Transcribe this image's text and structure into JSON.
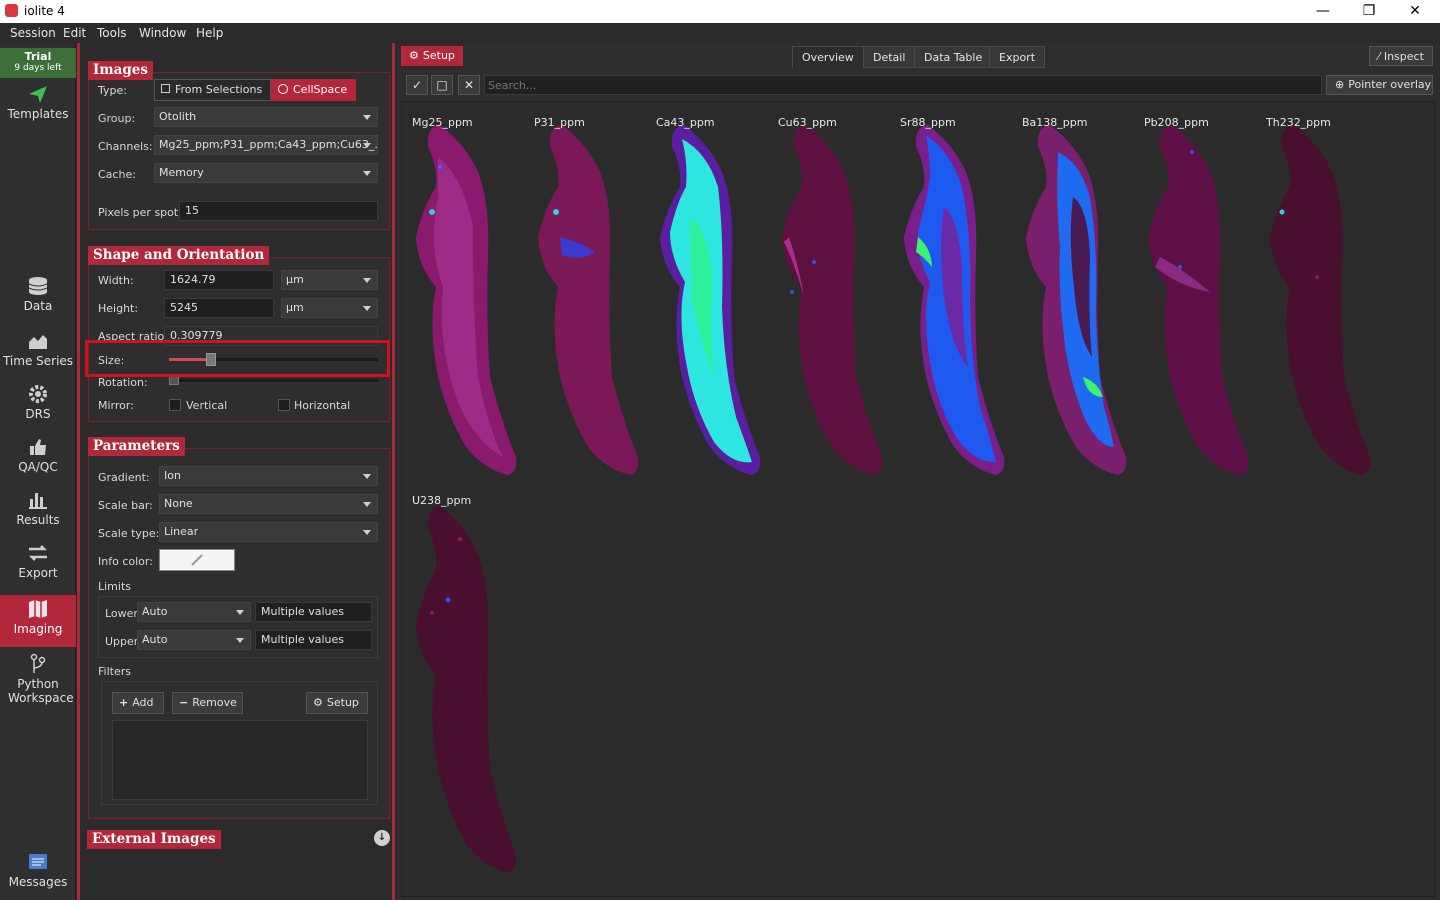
{
  "window": {
    "title": "iolite 4",
    "minimize": "—",
    "restore": "❐",
    "close": "✕"
  },
  "menu": [
    "Session",
    "Edit",
    "Tools",
    "Window",
    "Help"
  ],
  "trial": {
    "label": "Trial",
    "days": "9 days left"
  },
  "nav": {
    "templates": "Templates",
    "data": "Data",
    "time_series": "Time Series",
    "drs": "DRS",
    "qaqc": "QA/QC",
    "results": "Results",
    "export": "Export",
    "imaging": "Imaging",
    "python": "Python Workspace",
    "messages": "Messages"
  },
  "images_section": {
    "title": "Images",
    "type_label": "Type:",
    "from_selections": "From Selections",
    "cellspace": "CellSpace",
    "group_label": "Group:",
    "group_value": "Otolith",
    "channels_label": "Channels:",
    "channels_value": "Mg25_ppm;P31_ppm;Ca43_ppm;Cu63_...",
    "cache_label": "Cache:",
    "cache_value": "Memory",
    "pps_label": "Pixels per spot:",
    "pps_value": "15"
  },
  "shape_section": {
    "title": "Shape and Orientation",
    "width_label": "Width:",
    "width_value": "1624.79",
    "width_unit": "µm",
    "height_label": "Height:",
    "height_value": "5245",
    "height_unit": "µm",
    "aspect_label": "Aspect ratio:",
    "aspect_value": "0.309779",
    "size_label": "Size:",
    "size_level": 0.2,
    "rotation_label": "Rotation:",
    "mirror_label": "Mirror:",
    "vertical": "Vertical",
    "horizontal": "Horizontal"
  },
  "params_section": {
    "title": "Parameters",
    "gradient_label": "Gradient:",
    "gradient_value": "Ion",
    "scalebar_label": "Scale bar:",
    "scalebar_value": "None",
    "scaletype_label": "Scale type:",
    "scaletype_value": "Linear",
    "infocolor_label": "Info color:",
    "limits_label": "Limits",
    "lower_label": "Lower",
    "lower_value": "Auto",
    "lower_multi": "Multiple values",
    "upper_label": "Upper",
    "upper_value": "Auto",
    "upper_multi": "Multiple values",
    "filters_label": "Filters",
    "add": "Add",
    "remove": "Remove",
    "setup": "Setup"
  },
  "external_section": {
    "title": "External Images"
  },
  "main": {
    "setup": "Setup",
    "tabs": [
      "Overview",
      "Detail",
      "Data Table",
      "Export"
    ],
    "inspect": "Inspect",
    "search_placeholder": "Search...",
    "pointer_overlay": "Pointer overlay",
    "images": [
      "Mg25_ppm",
      "P31_ppm",
      "Ca43_ppm",
      "Cu63_ppm",
      "Sr88_ppm",
      "Ba138_ppm",
      "Pb208_ppm",
      "Th232_ppm",
      "U238_ppm"
    ]
  },
  "colors": {
    "accent": "#b3273b",
    "highlight": "#d0121e"
  }
}
